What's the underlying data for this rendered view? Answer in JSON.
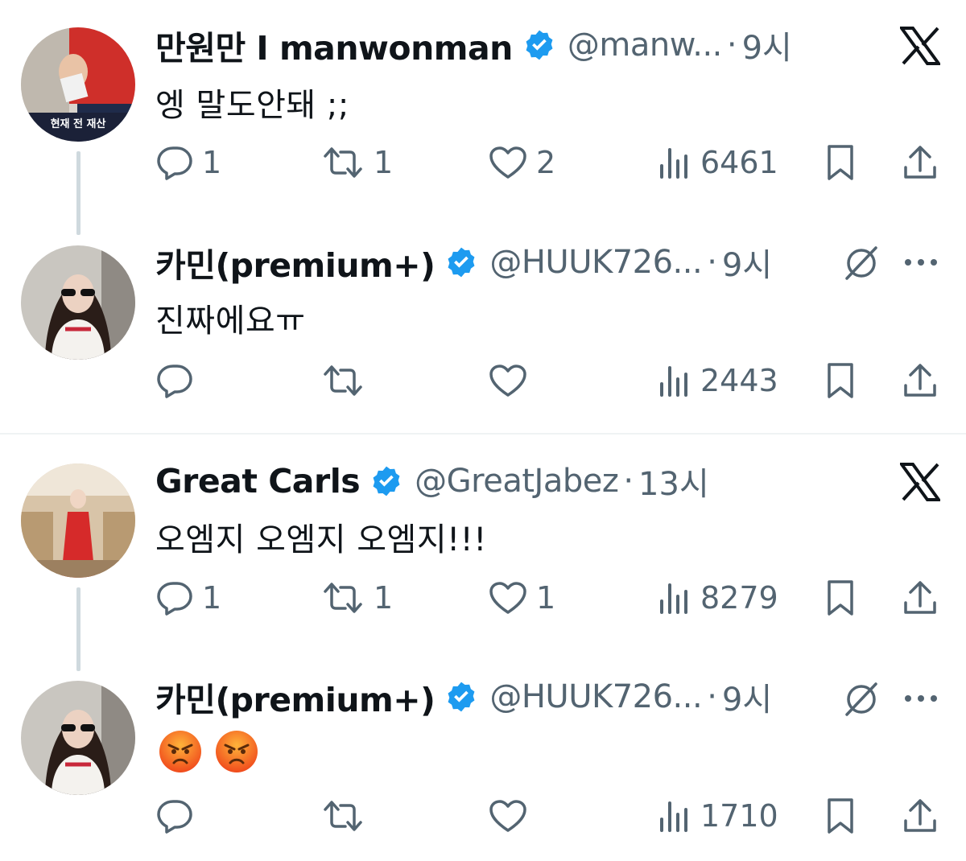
{
  "colors": {
    "accent": "#1d9bf0",
    "secondary_text": "#536471",
    "thread_line": "#cfd9de"
  },
  "tweets": [
    {
      "name": "만원만 I manwonman",
      "handle": "@manw...",
      "time": "9시",
      "text": "엥 말도안돼 ;;",
      "avatar_caption": "현재 전 재산",
      "reply_count": "1",
      "retweet_count": "1",
      "like_count": "2",
      "view_count": "6461",
      "top_right_icon": "x-logo-icon"
    },
    {
      "name": "카민(premium+)",
      "handle": "@HUUK726...",
      "time": "9시",
      "text": "진짜에요ㅠ",
      "reply_count": "",
      "retweet_count": "",
      "like_count": "",
      "view_count": "2443",
      "top_right_icon": "grok-icon"
    },
    {
      "name": "Great Carls",
      "handle": "@GreatJabez",
      "time": "13시",
      "text": "오엠지 오엠지 오엠지!!!",
      "reply_count": "1",
      "retweet_count": "1",
      "like_count": "1",
      "view_count": "8279",
      "top_right_icon": "x-logo-icon"
    },
    {
      "name": "카민(premium+)",
      "handle": "@HUUK726...",
      "time": "9시",
      "emoji_text": "😡 😡",
      "reply_count": "",
      "retweet_count": "",
      "like_count": "",
      "view_count": "1710",
      "top_right_icon": "grok-icon"
    }
  ],
  "separator": "·"
}
